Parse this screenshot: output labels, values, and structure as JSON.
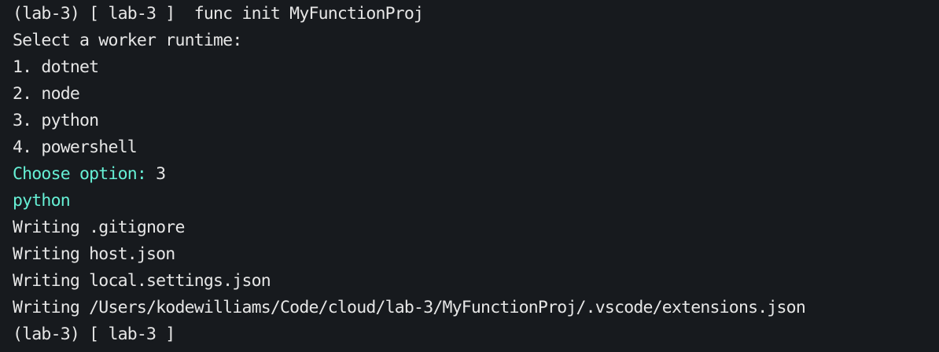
{
  "terminal": {
    "colors": {
      "background": "#171a1e",
      "text": "#e6e6e6",
      "accent": "#66f0d5"
    },
    "lines": {
      "l0": "(lab-3) [ lab-3 ]  func init MyFunctionProj",
      "l1": "Select a worker runtime:",
      "l2": "1. dotnet",
      "l3": "2. node",
      "l4": "3. python",
      "l5": "4. powershell",
      "l6_prompt": "Choose option: ",
      "l6_value": "3",
      "l7": "python",
      "l8": "Writing .gitignore",
      "l9": "Writing host.json",
      "l10": "Writing local.settings.json",
      "l11": "Writing /Users/kodewilliams/Code/cloud/lab-3/MyFunctionProj/.vscode/extensions.json",
      "l12": "(lab-3) [ lab-3 ]"
    }
  }
}
